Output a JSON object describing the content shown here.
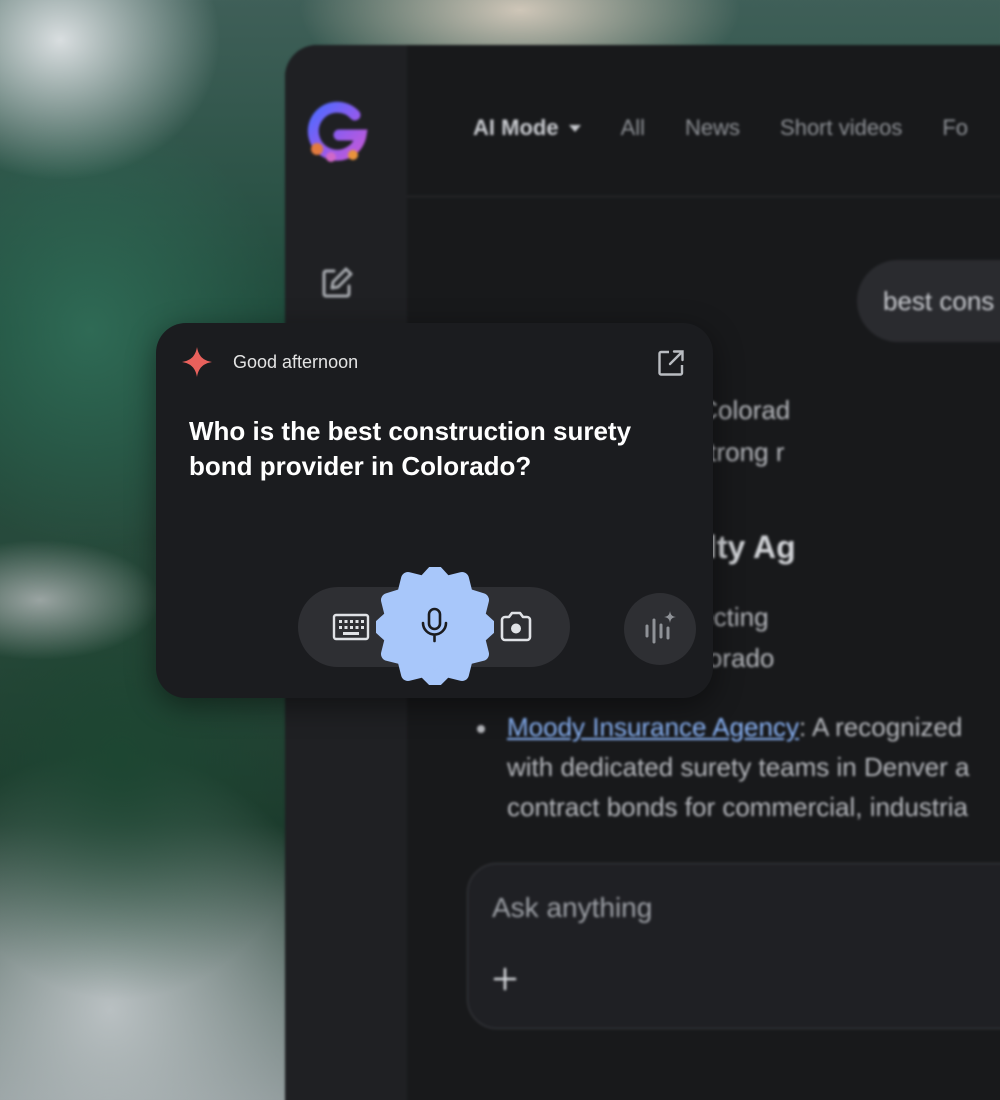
{
  "browser": {
    "tabs": [
      {
        "label": "AI Mode",
        "active": true
      },
      {
        "label": "All"
      },
      {
        "label": "News"
      },
      {
        "label": "Short videos"
      },
      {
        "label": "Fo"
      }
    ],
    "query_chip": "best cons",
    "answer_lines": [
      "ond providers in Colorad",
      "nal carriers with strong r",
      "orado Specialty Ag",
      "as brokers, connecting",
      "l expertise on Colorado"
    ],
    "bullet": {
      "link": "Moody Insurance Agency",
      "rest": ": A recognized",
      "line2": "with dedicated surety teams in Denver a",
      "line3": "contract bonds for commercial, industria"
    },
    "ask_placeholder": "Ask anything"
  },
  "card": {
    "greeting": "Good afternoon",
    "prompt": "Who is the best construction surety bond provider in Colorado?"
  },
  "colors": {
    "accent_spark": "#e8615c",
    "mic_blob": "#a8c7fa",
    "link": "#8ab4f8"
  },
  "icons": [
    "google-g-logo",
    "new-chat-icon",
    "sparkle-icon",
    "open-external-icon",
    "keyboard-icon",
    "microphone-icon",
    "camera-icon",
    "live-audio-icon",
    "plus-icon"
  ]
}
